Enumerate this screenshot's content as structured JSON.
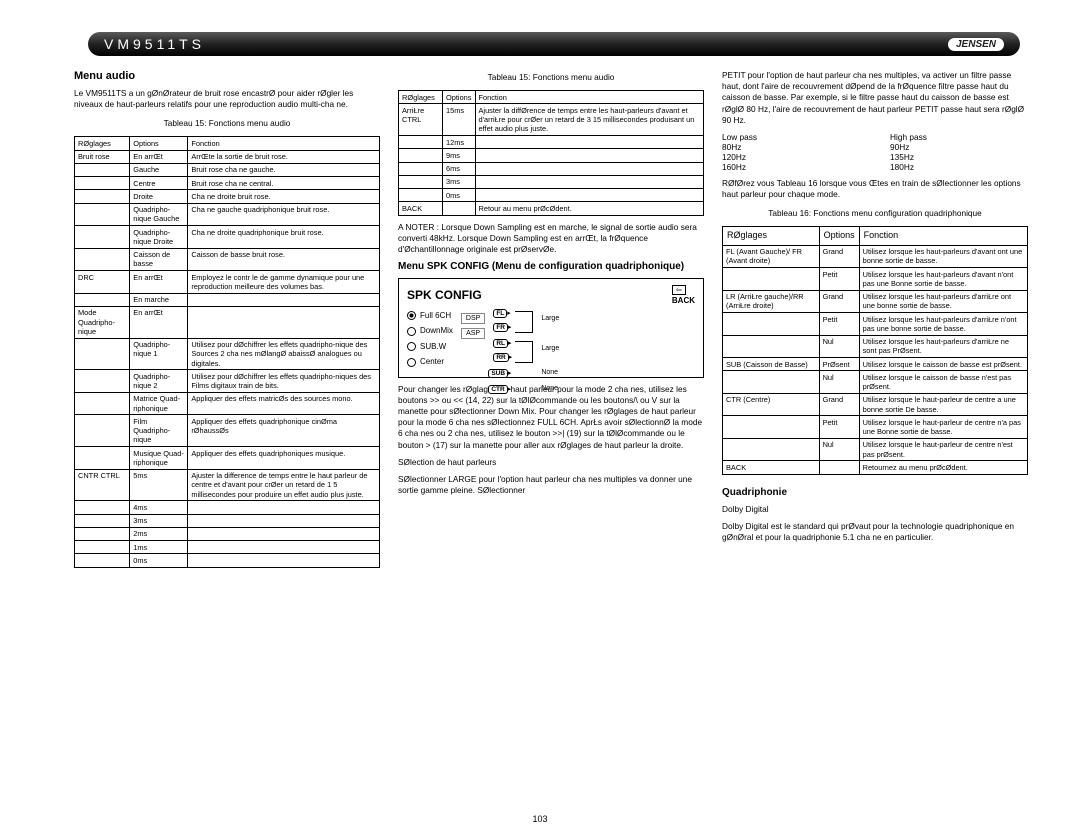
{
  "header": {
    "model": "VM9511TS",
    "brand": "JENSEN"
  },
  "col1": {
    "title": "Menu audio",
    "intro": "Le VM9511TS a un gØnØrateur de bruit rose encastrØ pour aider  rØgler les niveaux de haut-parleurs relatifs pour une reproduction audio multi-cha ne.",
    "t15cap": "Tableau 15: Fonctions menu audio",
    "t15": {
      "h": [
        "RØglages",
        "Options",
        "Fonction"
      ],
      "rows": [
        [
          "Bruit rose",
          "En arrŒt",
          "ArrŒte la sortie de bruit rose."
        ],
        [
          "",
          "Gauche",
          "Bruit rose cha ne gauche."
        ],
        [
          "",
          "Centre",
          "Bruit rose cha ne central."
        ],
        [
          "",
          "Droite",
          "Cha ne droite bruit rose."
        ],
        [
          "",
          "Quadripho-nique Gauche",
          "Cha ne gauche quadriphonique bruit rose."
        ],
        [
          "",
          "Quadripho-nique Droite",
          "Cha ne droite quadriphonique bruit rose."
        ],
        [
          "",
          "Caisson de basse",
          "Caisson de basse bruit rose."
        ],
        [
          "DRC",
          "En arrŒt",
          "Employez le contr le de gamme dynamique pour une  reproduction meilleure  des volumes bas."
        ],
        [
          "",
          "En marche",
          ""
        ],
        [
          "Mode Quadripho-nique",
          "En arrŒt",
          ""
        ],
        [
          "",
          "Quadripho-nique 1",
          "Utilisez pour dØchiffrer les effets quadripho-nique des Sources 2 cha nes mØlangØ abaissØ analogues ou digitales."
        ],
        [
          "",
          "Quadripho-nique 2",
          "Utilisez pour dØchiffrer les effets quadripho-niques des Films digitaux train de bits."
        ],
        [
          "",
          "Matrice Quad-riphonique",
          "Appliquer des effets matricØs  des sources mono."
        ],
        [
          "",
          "Film Quadripho-nique",
          "Appliquer des effets quadriphonique cinØma rØhaussØs"
        ],
        [
          "",
          "Musique Quad-riphonique",
          "Appliquer des effets quadriphoniques musique."
        ],
        [
          "CNTR CTRL",
          "5ms",
          "Ajuster la difference de temps entre le haut parleur de centre et d'avant pour crØer un retard de 1  5 millisecondes pour produire un effet audio plus juste."
        ],
        [
          "",
          "4ms",
          ""
        ],
        [
          "",
          "3ms",
          ""
        ],
        [
          "",
          "2ms",
          ""
        ],
        [
          "",
          "1ms",
          ""
        ],
        [
          "",
          "0ms",
          ""
        ]
      ]
    }
  },
  "col2": {
    "t15cap": "Tableau 15: Fonctions menu audio",
    "t15": {
      "h": [
        "RØglages",
        "Options",
        "Fonction"
      ],
      "rows": [
        [
          "ArriŁre CTRL",
          "15ms",
          "Ajuster la diffØrence de temps entre les haut-parleurs d'avant et d'arriŁre pour crØer un retard de 3  15 millisecondes produisant un effet audio plus juste."
        ],
        [
          "",
          "12ms",
          ""
        ],
        [
          "",
          "9ms",
          ""
        ],
        [
          "",
          "6ms",
          ""
        ],
        [
          "",
          "3ms",
          ""
        ],
        [
          "",
          "0ms",
          ""
        ],
        [
          "BACK",
          "",
          "Retour au menu prØcØdent."
        ]
      ]
    },
    "note": "A NOTER : Lorsque Down Sampling est en marche, le signal de sortie audio sera converti  48kHz. Lorsque Down Sampling est en arrŒt, la frØquence d'Øchantillonnage originale est prØservØe.",
    "spk_title": "Menu SPK CONFIG (Menu de configuration quadriphonique)",
    "spk": {
      "title": "SPK CONFIG",
      "back": "BACK",
      "left": [
        "Full 6CH",
        "DownMix",
        "SUB.W",
        "Center"
      ],
      "mid": [
        "DSP",
        "ASP"
      ],
      "labels": {
        "FL": "FL",
        "FR": "FR",
        "RL": "RL",
        "RR": "RR",
        "SUB": "SUB",
        "CTR": "CTR"
      },
      "vals": [
        "Large",
        "Large",
        "None",
        "None"
      ]
    },
    "p1": "Pour changer les rØglages de haut parleur pour la mode 2 cha nes, utilisez les boutons >> ou << (14, 22) sur la tØlØcommande ou les boutons/\\ ou V sur la manette pour sØlectionner Down Mix. Pour changer les rØglages de haut parleur pour la mode 6 cha nes sØlectionnez FULL 6CH. AprŁs avoir sØlectionnØ la mode 6 cha nes ou 2 cha nes, utilisez le bouton >>| (19) sur la tØlØcommande ou le bouton > (17) sur la manette pour aller aux rØglages de haut parleur  la droite.",
    "p2": "SØlection de haut parleurs",
    "p3": "SØlectionner LARGE pour l'option haut parleur  cha nes multiples va donner une sortie  gamme pleine. SØlectionner"
  },
  "col3": {
    "p0": "PETIT pour l'option de haut parleur  cha nes multiples, va activer un filtre passe haut, dont l'aire de recouvrement dØpend de la frØquence  filtre passe haut du caisson de basse. Par exemple, si le filtre  passe haut du caisson de basse est rØglØ  80 Hz, l'aire de recouvrement de haut parleur PETIT  passe haut sera rØglØ  90 Hz.",
    "freq": {
      "l": [
        "Low pass",
        "80Hz",
        "120Hz",
        "160Hz"
      ],
      "r": [
        "High pass",
        "90Hz",
        "135Hz",
        "180Hz"
      ]
    },
    "p1": "RØfØrez vous  Tableau 16 lorsque vous Œtes en train de sØlectionner les options haut parleur pour chaque mode.",
    "t16cap": "Tableau 16: Fonctions menu configuration quadriphonique",
    "t16": {
      "h": [
        "RØglages",
        "Options",
        "Fonction"
      ],
      "rows": [
        [
          "FL (Avant Gauche)/ FR (Avant droite)",
          "Grand",
          "Utilisez lorsque les haut-parleurs d'avant ont une bonne sortie de basse."
        ],
        [
          "",
          "Petit",
          "Utilisez lorsque les haut-parleurs d'avant n'ont pas une Bonne sortie de basse."
        ],
        [
          "LR (ArriŁre gauche)/RR (ArriŁre droite)",
          "Grand",
          "Utilisez lorsque les haut-parleurs d'arriŁre ont une bonne  sortie de basse."
        ],
        [
          "",
          "Petit",
          "Utilisez lorsque les haut-parleurs d'arriŁre n'ont pas une bonne sortie de basse."
        ],
        [
          "",
          "Nul",
          "Utilisez lorsque les haut-parleurs d'arriŁre ne sont pas PrØsent."
        ],
        [
          "SUB (Caisson de Basse)",
          "PrØsent",
          "Utilisez lorsque le caisson de basse est prØsent."
        ],
        [
          "",
          "Nul",
          "Utilisez lorsque le caisson de basse n'est pas prØsent."
        ],
        [
          "CTR (Centre)",
          "Grand",
          "Utilisez lorsque le haut-parleur de centre a une bonne sortie De basse."
        ],
        [
          "",
          "Petit",
          "Utilisez lorsque le haut-parleur de centre n'a pas une Bonne sortie de basse."
        ],
        [
          "",
          "Nul",
          "Utilisez lorsque le haut-parleur de centre n'est pas prØsent."
        ],
        [
          "BACK",
          "",
          "Retournez au menu prØcØdent."
        ]
      ]
    },
    "quad_h": "Quadriphonie",
    "quad_sub": "Dolby Digital",
    "quad_p": "Dolby Digital est le standard qui prØvaut pour la technologie quadriphonique en gØnØral et pour la quadriphonie  5.1 cha ne en particulier."
  },
  "pagenum": "103"
}
